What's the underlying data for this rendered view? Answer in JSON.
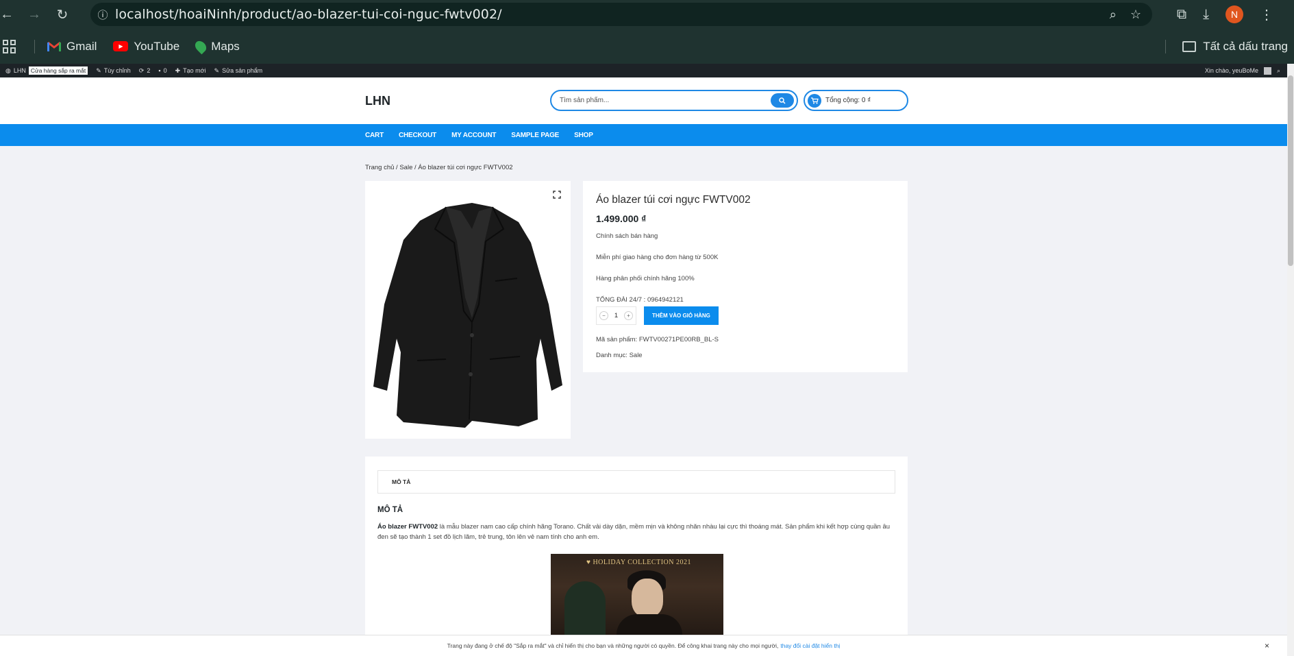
{
  "browser": {
    "url": "localhost/hoaiNinh/product/ao-blazer-tui-coi-nguc-fwtv002/",
    "profile_initial": "N",
    "bookmarks": [
      "Gmail",
      "YouTube",
      "Maps"
    ],
    "all_bookmarks_label": "Tất cả dấu trang"
  },
  "adminbar": {
    "site": "LHN",
    "badge": "Cửa hàng sắp ra mắt",
    "customize": "Tùy chỉnh",
    "updates": "2",
    "comments": "0",
    "new": "Tạo mới",
    "edit": "Sửa sản phẩm",
    "greeting": "Xin chào, yeuBoMe"
  },
  "header": {
    "logo": "LHN",
    "search_placeholder": "Tìm sản phẩm...",
    "cart_total": "Tổng cộng: 0 ₫"
  },
  "nav": [
    "CART",
    "CHECKOUT",
    "MY ACCOUNT",
    "SAMPLE PAGE",
    "SHOP"
  ],
  "breadcrumb": "Trang chủ / Sale / Áo blazer túi cơi ngực FWTV002",
  "product": {
    "title": "Áo blazer túi cơi ngực FWTV002",
    "price": "1.499.000 ₫",
    "policy_title": "Chính sách bán hàng",
    "policy_1": "Miễn phí giao hàng cho đơn hàng từ 500K",
    "policy_2": "Hàng phân phối chính hãng 100%",
    "hotline": "TỔNG ĐÀI 24/7 : 0964942121",
    "quantity": "1",
    "add_to_cart": "THÊM VÀO GIỎ HÀNG",
    "sku": "Mã sản phẩm: FWTV00271PE00RB_BL-S",
    "category": "Danh mục: Sale"
  },
  "description": {
    "tab": "MÔ TẢ",
    "heading": "MÔ TẢ",
    "bold_name": "Áo blazer FWTV002",
    "text": " là mẫu blazer nam cao cấp chính hãng Torano. Chất vải dày dặn, mềm mịn và không nhăn nhàu lại cực thì thoáng mát. Sản phẩm khi kết hợp cùng quần âu đen sẽ tạo thành 1 set đồ lịch lãm, trẻ trung, tôn lên vẻ nam tính cho anh em.",
    "banner_text": "♥ HOLIDAY COLLECTION 2021"
  },
  "notice": {
    "text": "Trang này đang ở chế độ \"Sắp ra mắt\" và chỉ hiển thị cho bạn và những người có quyền. Để công khai trang này cho mọi người,",
    "link": "thay đổi cài đặt hiển thị",
    "close": "×"
  }
}
